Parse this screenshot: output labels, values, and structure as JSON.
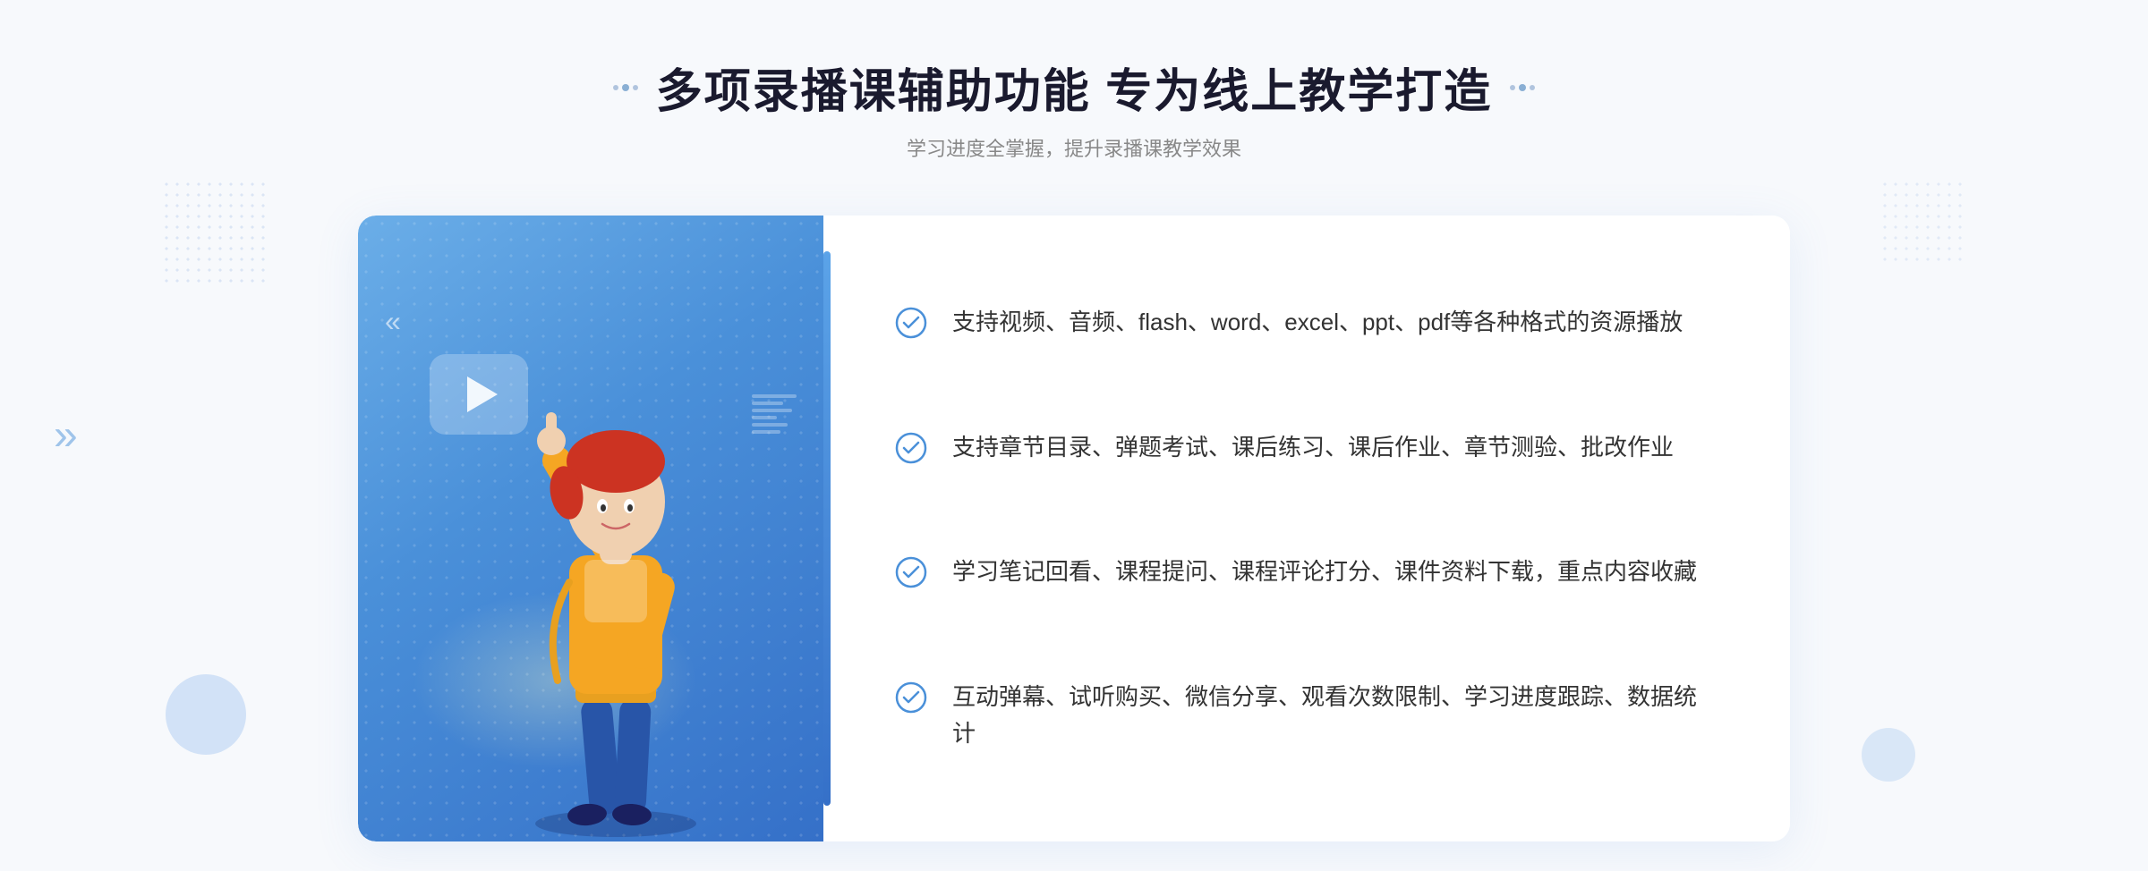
{
  "header": {
    "main_title": "多项录播课辅助功能 专为线上教学打造",
    "sub_title": "学习进度全掌握，提升录播课教学效果"
  },
  "features": [
    {
      "id": 1,
      "text": "支持视频、音频、flash、word、excel、ppt、pdf等各种格式的资源播放"
    },
    {
      "id": 2,
      "text": "支持章节目录、弹题考试、课后练习、课后作业、章节测验、批改作业"
    },
    {
      "id": 3,
      "text": "学习笔记回看、课程提问、课程评论打分、课件资料下载，重点内容收藏"
    },
    {
      "id": 4,
      "text": "互动弹幕、试听购买、微信分享、观看次数限制、学习进度跟踪、数据统计"
    }
  ],
  "colors": {
    "title": "#1a1a2e",
    "subtitle": "#888888",
    "feature_text": "#333333",
    "check_color": "#4a90d9",
    "blue_gradient_start": "#6baee8",
    "blue_gradient_end": "#3570c8"
  },
  "icons": {
    "check": "check-circle-icon",
    "play": "play-icon",
    "chevron": "chevron-icon"
  }
}
